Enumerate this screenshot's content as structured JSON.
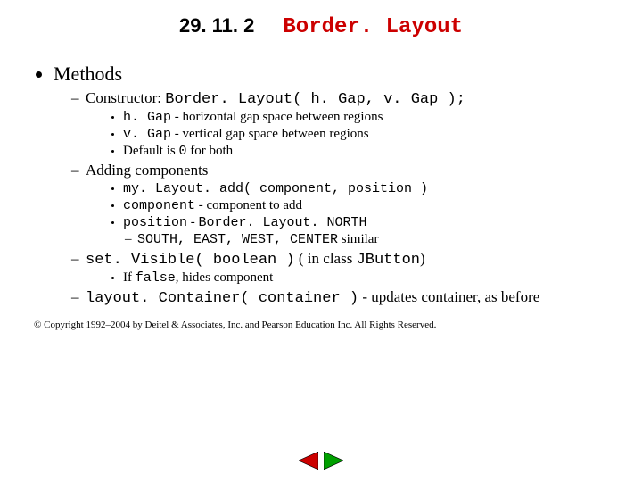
{
  "title": {
    "number": "29. 11. 2",
    "name": "Border. Layout"
  },
  "bullet_main": "Methods",
  "constructor": {
    "label": "Constructor: ",
    "code": "Border. Layout( h. Gap, v. Gap );",
    "hgap_code": "h. Gap",
    "hgap_dash": " - ",
    "hgap_text": "horizontal gap space between regions",
    "vgap_code": "v. Gap",
    "vgap_dash": " - ",
    "vgap_text": "vertical gap space between regions",
    "default_a": "Default is ",
    "default_code": "0",
    "default_b": " for both"
  },
  "adding": {
    "label": "Adding components",
    "add_code": "my. Layout. add( component, position )",
    "comp_code": "component",
    "comp_dash": " - ",
    "comp_text": "component to add",
    "pos_code_a": "position",
    "pos_dash": " - ",
    "pos_code_b": "Border. Layout. NORTH",
    "others_code": "SOUTH, EAST, WEST, CENTER",
    "others_text": " similar"
  },
  "setvisible": {
    "code": "set. Visible( boolean )",
    "mid": "  ( in class ",
    "jbutton": "JButton",
    "end": ")",
    "if": "If ",
    "false_code": "false",
    "hides": ", hides component"
  },
  "layoutcontainer": {
    "code": "layout. Container( container )",
    "dash": " - ",
    "text": "updates container, as before"
  },
  "copyright": "© Copyright 1992–2004 by Deitel & Associates, Inc. and Pearson Education Inc. All Rights Reserved."
}
